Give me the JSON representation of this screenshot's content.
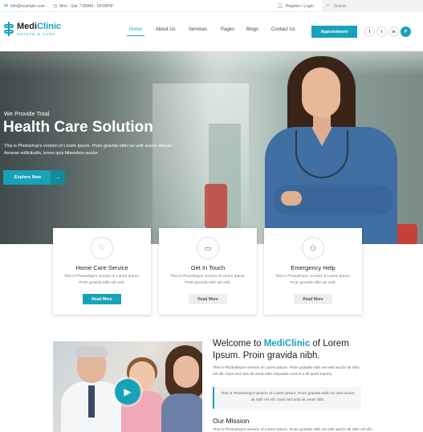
{
  "topbar": {
    "email": "info@example.com",
    "hours": "Mon - Sat: 7:00AM - 18:00PM",
    "account": "Register / Login",
    "search_placeholder": "Search"
  },
  "header": {
    "logo_name_part1": "Medi",
    "logo_name_part2": "Clinic",
    "logo_tagline": "HEALTH & CARE",
    "nav": [
      {
        "label": "Home",
        "active": true
      },
      {
        "label": "About Us",
        "active": false
      },
      {
        "label": "Services",
        "active": false
      },
      {
        "label": "Pages",
        "active": false
      },
      {
        "label": "Blogs",
        "active": false
      },
      {
        "label": "Contact Us",
        "active": false
      }
    ],
    "appointment_label": "Appointment",
    "social": [
      {
        "label": "f",
        "icon": "facebook-icon"
      },
      {
        "label": "t",
        "icon": "twitter-icon"
      },
      {
        "label": "in",
        "icon": "linkedin-icon"
      },
      {
        "label": "P",
        "icon": "pinterest-icon"
      }
    ]
  },
  "hero": {
    "subtitle": "We Provide Total",
    "title": "Health Care Solution",
    "text": "This is Photoshop's version  of Lorem Ipsum. Proin gravida nibh vel velit auctor aliquet. Aenean sollicitudin, lorem quis bibendum auctor.",
    "button_label": "Explore Now"
  },
  "services": [
    {
      "title": "Home Care Service",
      "text": "This is Photoshop's version of Lorem Ipsum. Proin gravida nibh vel velit.",
      "button_label": "Read More",
      "icon": "heart-pulse-icon"
    },
    {
      "title": "Get In Touch",
      "text": "This is Photoshop's version of Lorem Ipsum. Proin gravida nibh vel velit.",
      "button_label": "Read More",
      "icon": "chat-icon"
    },
    {
      "title": "Emergency Help",
      "text": "This is Photoshop's version of Lorem Ipsum. Proin gravida nibh vel velit.",
      "button_label": "Read More",
      "icon": "user-help-icon"
    }
  ],
  "welcome": {
    "title_pre": "Welcome to ",
    "title_brand": "MediClinic",
    "title_post": " of Lorem Ipsum. Proin gravida nibh.",
    "text": "This is Photoshop's version of Lorem Ipsum. Proin gravida nibh vel velit auctor ali nibh vel elit. Duis sed odio sit amet nibh vulputate cursus a sit amet mauris.",
    "quote": "This is Photoshop's version of Lorem Ipsum. Proin gravida nibh vel velit auctor ali nibh vel elit. Duis sed odio sit amet nibh.",
    "mission_title": "Our Mission",
    "mission_text": "This is Photoshop's version of Lorem Ipsum. Proin gravida nibh vel velit auctor ali nibh vel elit."
  },
  "colors": {
    "accent": "#17a2b8",
    "text": "#222222",
    "muted": "#777777"
  }
}
